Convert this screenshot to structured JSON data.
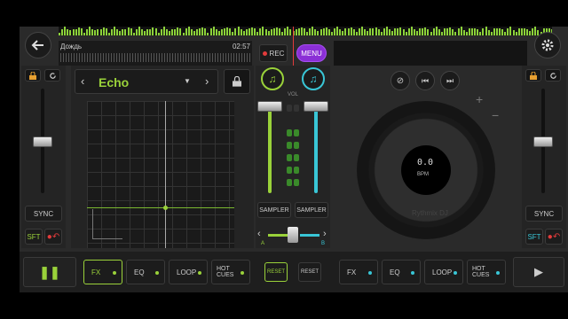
{
  "colors": {
    "accent_green": "#9ad23a",
    "accent_cyan": "#39c6d6",
    "menu_purple": "#8b2fd6",
    "rec_red": "#e23b3b"
  },
  "top": {
    "track_title": "Дождь",
    "track_time": "02:57",
    "rec_label": "REC",
    "menu_label": "MENU"
  },
  "fx_panel": {
    "effect_name": "Echo"
  },
  "mixer": {
    "vol_label": "VOL",
    "sampler_a": "SAMPLER",
    "sampler_b": "SAMPLER",
    "a_label": "A",
    "b_label": "B"
  },
  "left_deck": {
    "sync_label": "SYNC",
    "sft_label": "SFT"
  },
  "right_deck": {
    "sync_label": "SYNC",
    "sft_label": "SFT",
    "bpm_value": "0.0",
    "bpm_label": "BPM",
    "brand": "Rythmix DJ",
    "plus": "+",
    "minus": "−"
  },
  "bottom_left": {
    "fx": "FX",
    "eq": "EQ",
    "loop": "LOOP",
    "hot_cues": "HOT CUES",
    "reset": "RESET"
  },
  "bottom_right": {
    "fx": "FX",
    "eq": "EQ",
    "loop": "LOOP",
    "hot_cues": "HOT CUES",
    "reset": "RESET"
  },
  "icons": [
    "back-arrow-icon",
    "settings-gear-icon",
    "lock-icon",
    "refresh-icon",
    "music-note-icon",
    "link-icon",
    "previous-icon",
    "next-icon",
    "pause-icon",
    "play-icon",
    "chevron-left-icon",
    "chevron-right-icon",
    "dropdown-arrow-icon"
  ]
}
